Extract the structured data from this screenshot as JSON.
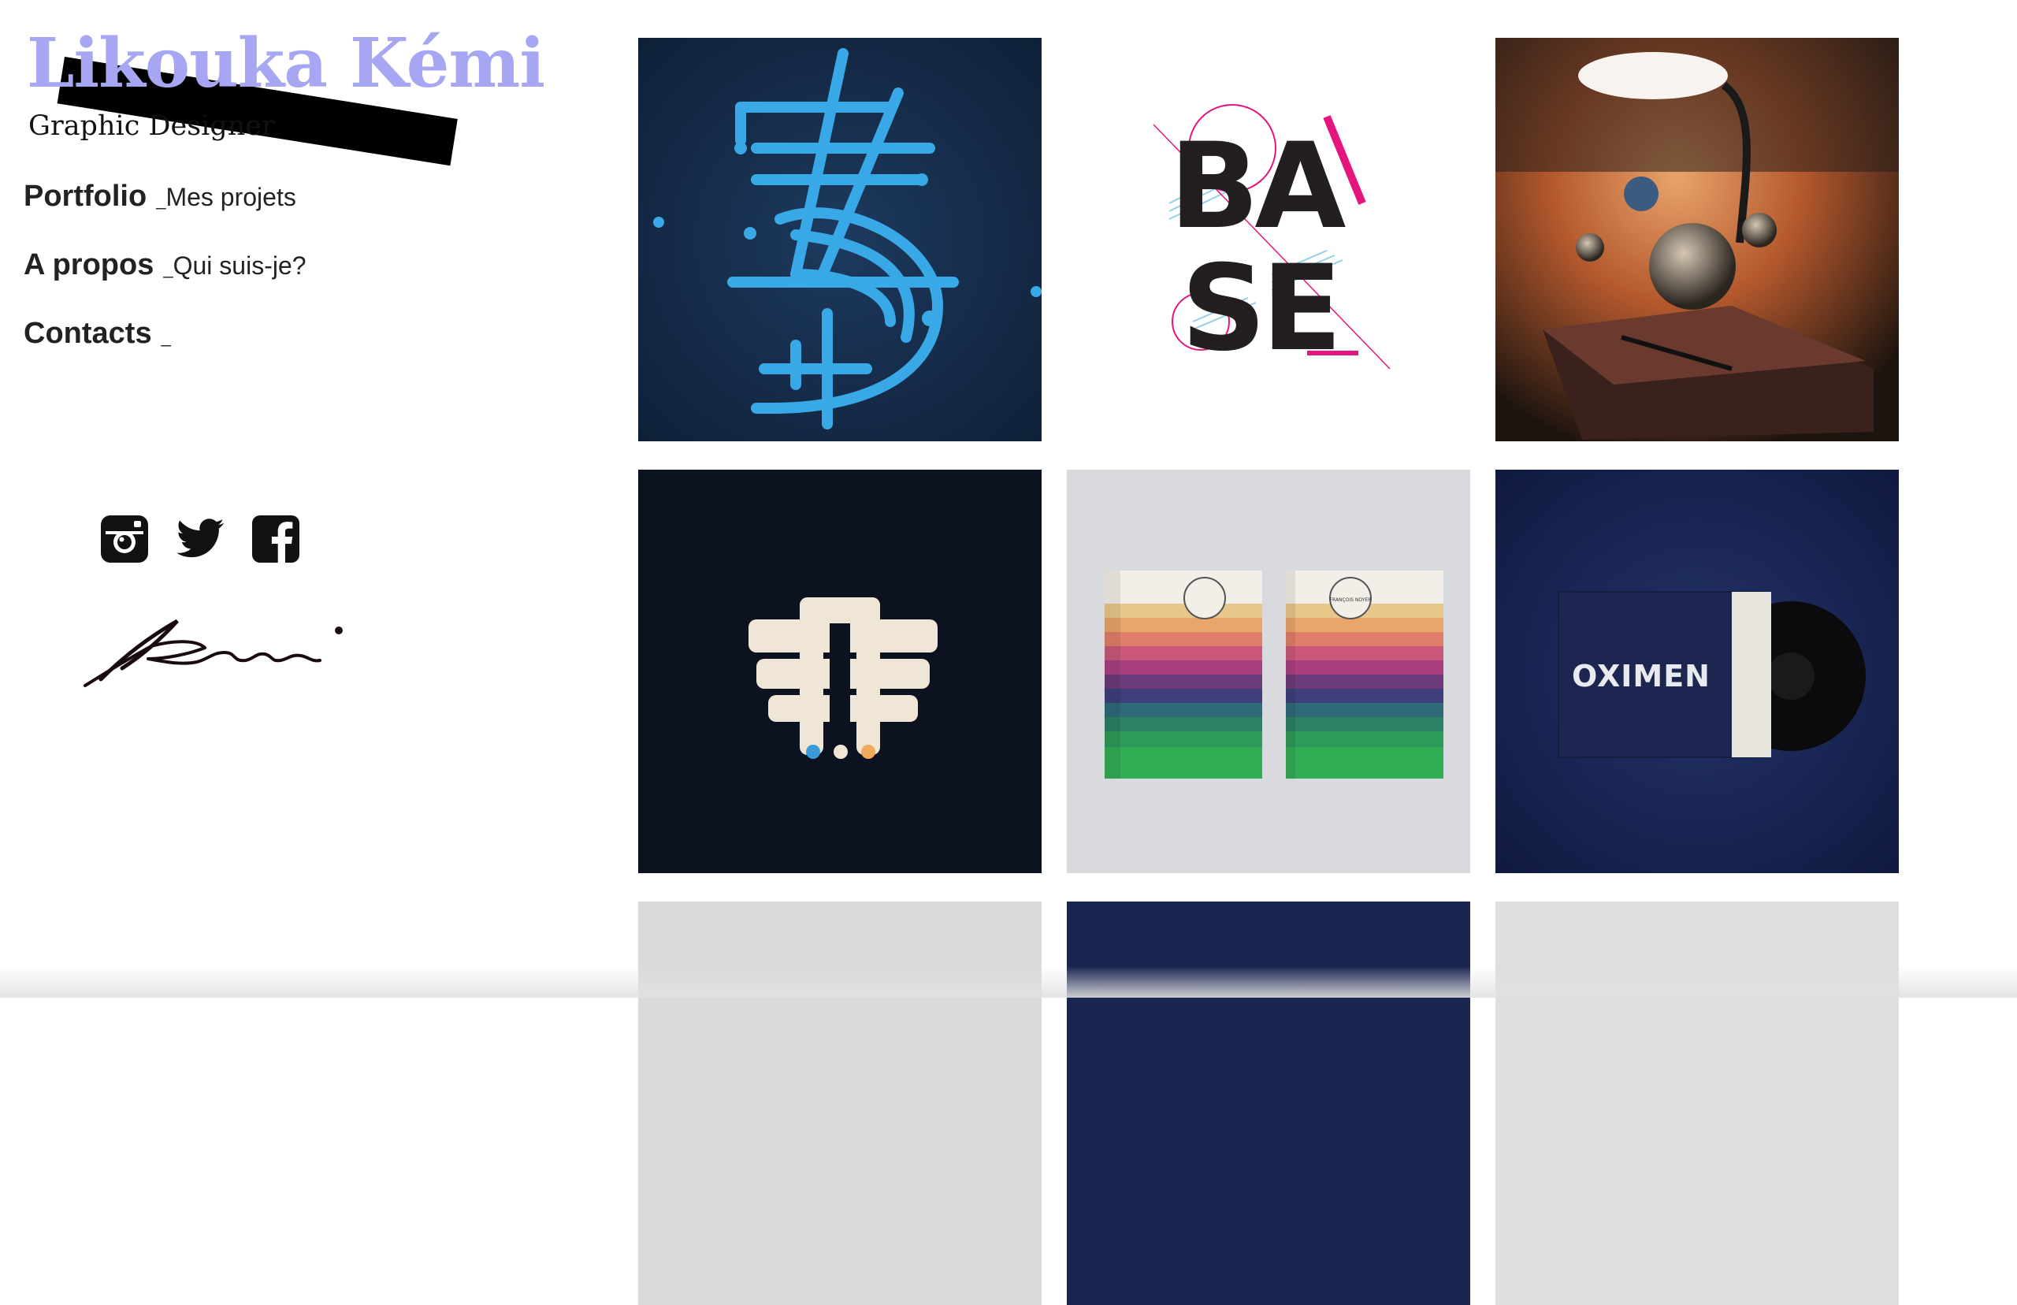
{
  "brand": {
    "name": "Likouka Kémi",
    "subtitle": "Graphic Designer",
    "accent": "#a6a6f2"
  },
  "nav": [
    {
      "title": "Portfolio",
      "sub": "Mes projets"
    },
    {
      "title": "A propos",
      "sub": "Qui suis-je?"
    },
    {
      "title": "Contacts",
      "sub": ""
    }
  ],
  "socials": [
    "instagram-icon",
    "twitter-icon",
    "facebook-icon"
  ],
  "signature": "signature",
  "portfolio": {
    "tiles": [
      {
        "id": "neon-73",
        "bg": "#122743"
      },
      {
        "id": "base",
        "text_top": "BA",
        "text_bottom": "SE",
        "bg": "#ffffff",
        "accent": "#e6157d"
      },
      {
        "id": "desk-lamp-planets",
        "bg": "#3b2a1e"
      },
      {
        "id": "eagle-emblem",
        "bg": "#0c1220",
        "dot_colors": [
          "#3a9ad9",
          "#f0e6d6",
          "#f2a95c"
        ]
      },
      {
        "id": "francois-noyer-boxes",
        "box_label": "FRANÇOIS NOYER",
        "bg": "#d8dadd"
      },
      {
        "id": "oximen-vinyl",
        "album_title": "OXIMEN",
        "bg": "#1a2553"
      },
      {
        "id": "partial-light",
        "bg": "#d9dadc"
      },
      {
        "id": "partial-navy",
        "bg": "#1a2550"
      },
      {
        "id": "partial-light-2",
        "bg": "#dddedf"
      }
    ]
  }
}
